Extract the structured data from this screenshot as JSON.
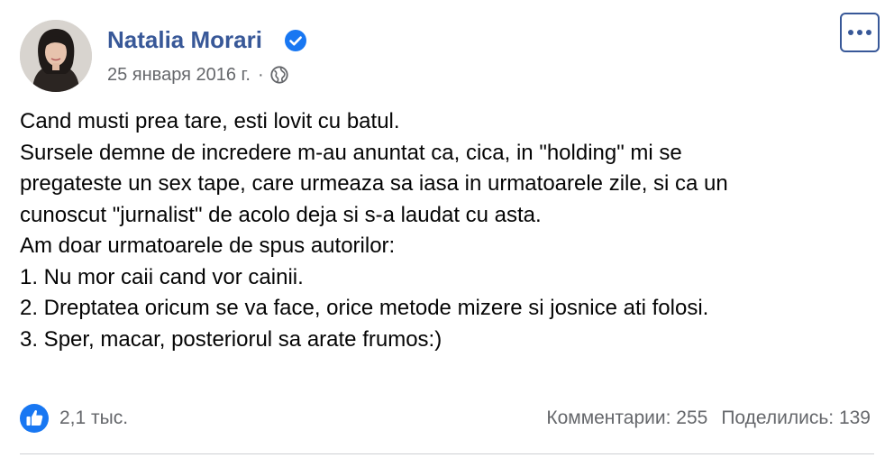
{
  "post": {
    "author": "Natalia Morari",
    "verified": true,
    "timestamp": "25 января 2016 г.",
    "separator": "·",
    "audience_icon": "globe-icon",
    "more_icon": "more-options-icon",
    "body_lines": [
      "Cand musti prea tare, esti lovit cu batul.",
      "Sursele demne de incredere m-au anuntat ca, cica, in \"holding\" mi se",
      "pregateste un sex tape, care urmeaza sa iasa in urmatoarele zile, si ca un",
      "cunoscut \"jurnalist\" de acolo deja si s-a laudat cu asta.",
      "Am doar urmatoarele de spus autorilor:",
      "1. Nu mor caii cand vor cainii.",
      "2. Dreptatea oricum se va face, orice metode mizere si josnice ati folosi.",
      "3. Sper, macar, posteriorul sa arate frumos:)"
    ]
  },
  "footer": {
    "reaction_icon": "like-icon",
    "reactions": "2,1 тыс.",
    "comments": "Комментарии: 255",
    "shares": "Поделились: 139"
  },
  "colors": {
    "name": "#385898",
    "text": "#050505",
    "secondary": "#65676b",
    "like_blue": "#1877f2",
    "divider": "#ced0d4"
  }
}
